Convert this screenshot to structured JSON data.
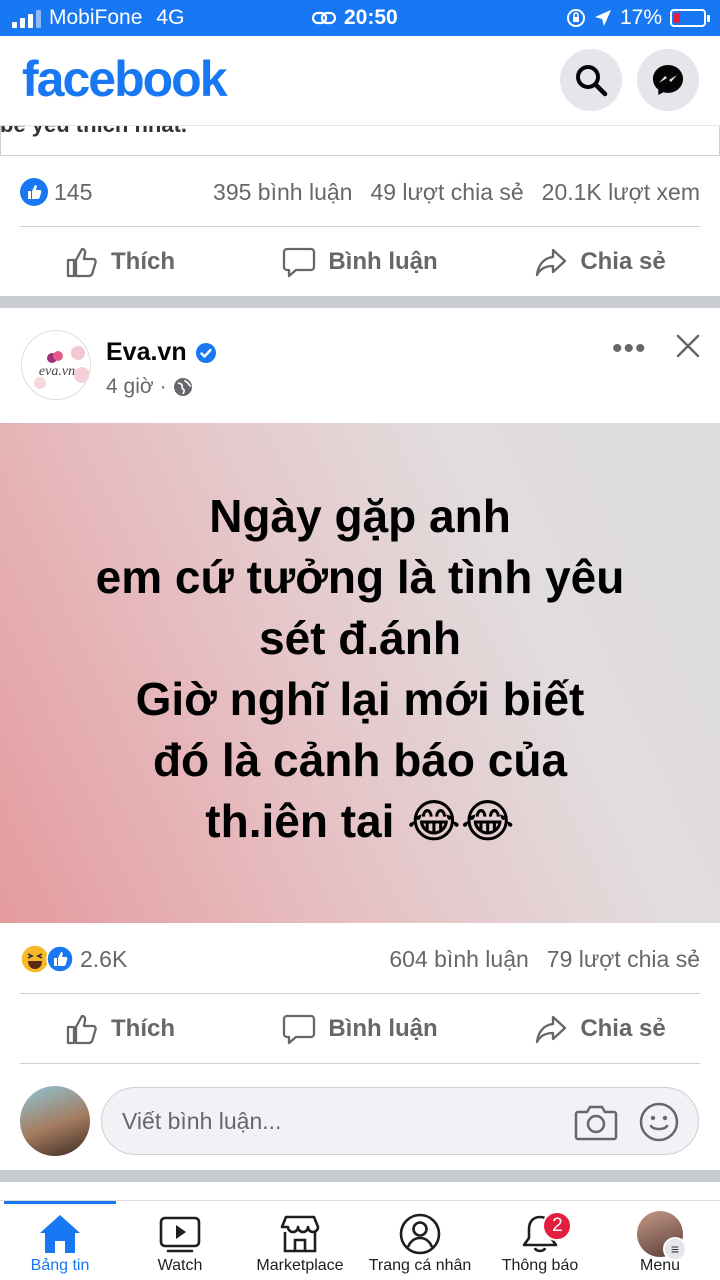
{
  "status_bar": {
    "carrier": "MobiFone",
    "network": "4G",
    "time": "20:50",
    "battery": "17%"
  },
  "header": {
    "logo": "facebook",
    "icons": [
      "search-icon",
      "messenger-icon"
    ]
  },
  "previous_post": {
    "cut_text": "bé yêu thích nhất.",
    "likes": "145",
    "comments": "395 bình luận",
    "shares": "49 lượt chia sẻ",
    "views": "20.1K lượt xem"
  },
  "actions": {
    "like": "Thích",
    "comment": "Bình luận",
    "share": "Chia sẻ"
  },
  "post": {
    "page_name": "Eva.vn",
    "time": "4 giờ",
    "lines": [
      "Ngày gặp anh",
      "em cứ tưởng là tình yêu",
      "sét đ.ánh",
      "Giờ nghĩ lại mới biết",
      "đó là cảnh báo của",
      "th.iên tai 😂😂"
    ],
    "reactions": "2.6K",
    "comments": "604 bình luận",
    "shares": "79 lượt chia sẻ"
  },
  "comment_box": {
    "placeholder": "Viết bình luận..."
  },
  "bottom_nav": {
    "items": [
      {
        "label": "Bảng tin",
        "icon": "home-icon"
      },
      {
        "label": "Watch",
        "icon": "watch-icon"
      },
      {
        "label": "Marketplace",
        "icon": "marketplace-icon"
      },
      {
        "label": "Trang cá nhân",
        "icon": "profile-icon"
      },
      {
        "label": "Thông báo",
        "icon": "bell-icon",
        "badge": "2"
      },
      {
        "label": "Menu",
        "icon": "menu-avatar"
      }
    ]
  },
  "colors": {
    "brand": "#1877f2",
    "badge": "#e41e3f",
    "secondary_text": "#65676b"
  }
}
